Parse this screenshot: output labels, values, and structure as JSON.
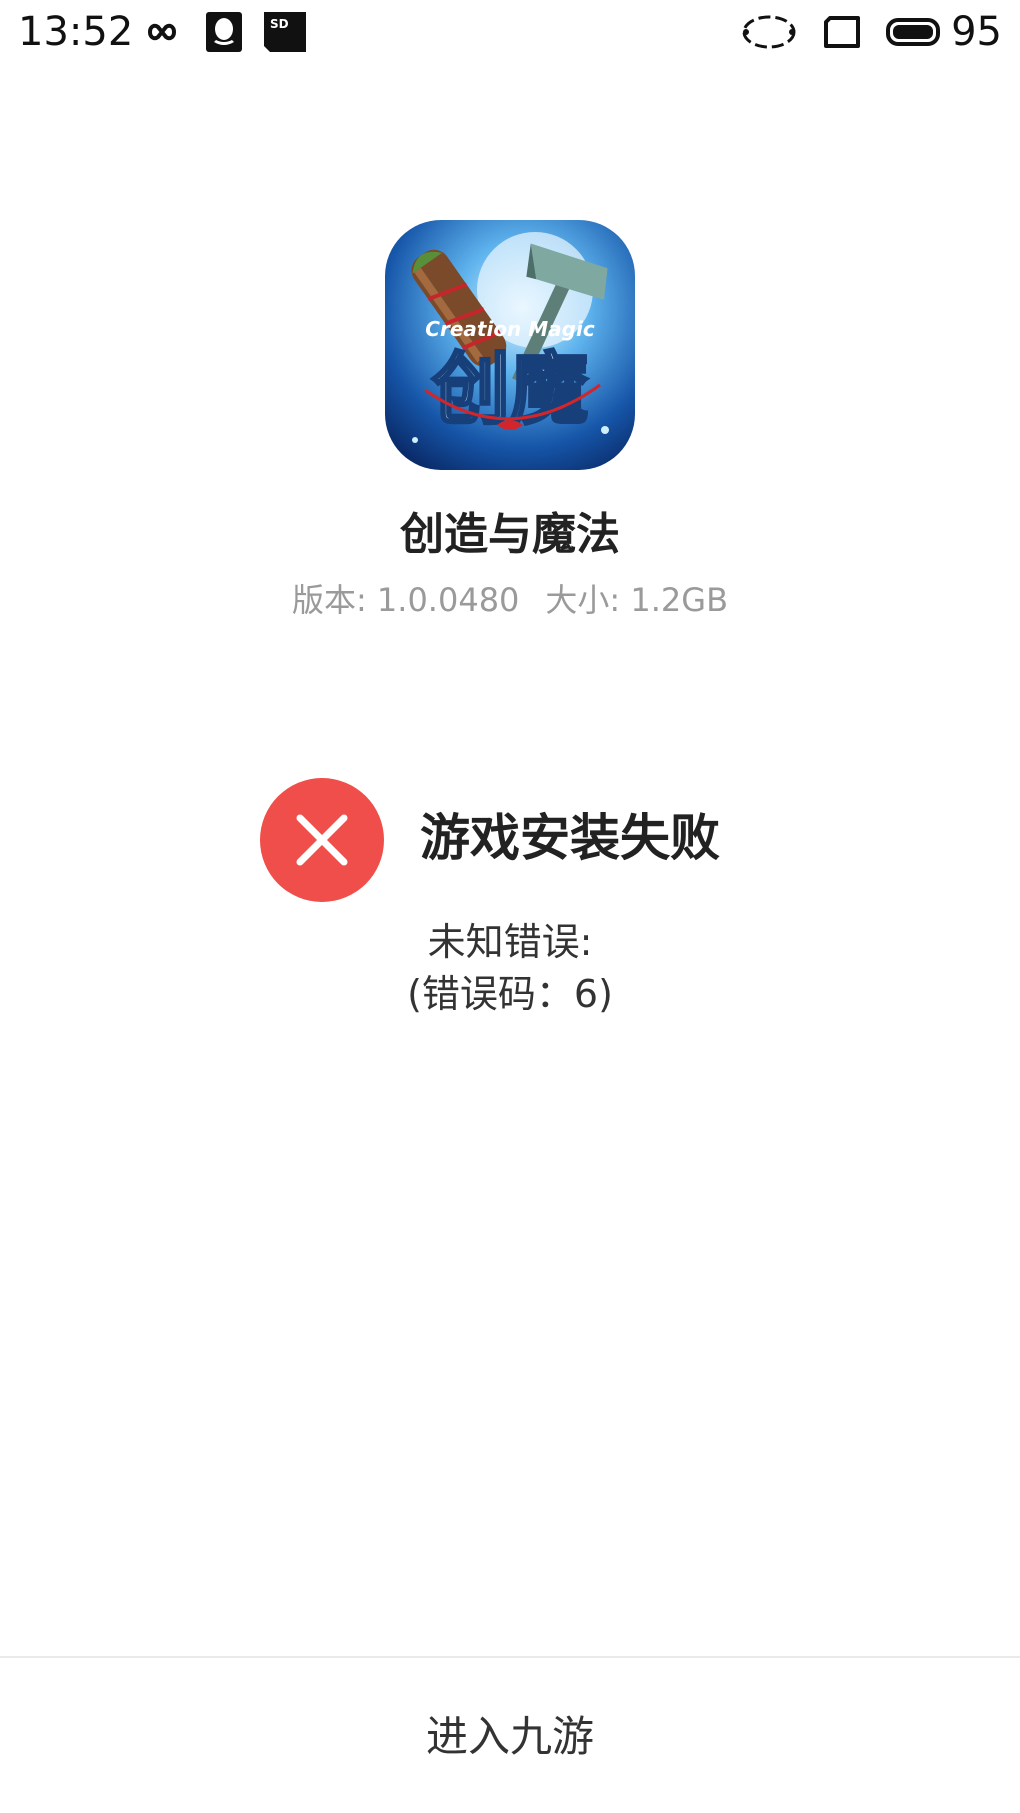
{
  "status_bar": {
    "time": "13:52",
    "icons": [
      "infinity-icon",
      "qq-icon",
      "sd-card-icon",
      "sync-icon",
      "screen-rotate-icon",
      "battery-icon"
    ],
    "sd_label": "SD",
    "battery_level": "95"
  },
  "app": {
    "icon": "creation-magic-app-icon",
    "icon_text_top": "Creation Magic",
    "icon_text_main": "创魔",
    "name": "创造与魔法",
    "version_label": "版本: 1.0.0480",
    "size_label": "大小: 1.2GB"
  },
  "error": {
    "icon": "error-x-icon",
    "title": "游戏安装失败",
    "message_line1": "未知错误:",
    "message_line2": "(错误码：6)"
  },
  "bottom": {
    "button_label": "进入九游"
  },
  "colors": {
    "error_red": "#f04e4b",
    "meta_gray": "#9a9a9a",
    "text_dark": "#222222"
  }
}
